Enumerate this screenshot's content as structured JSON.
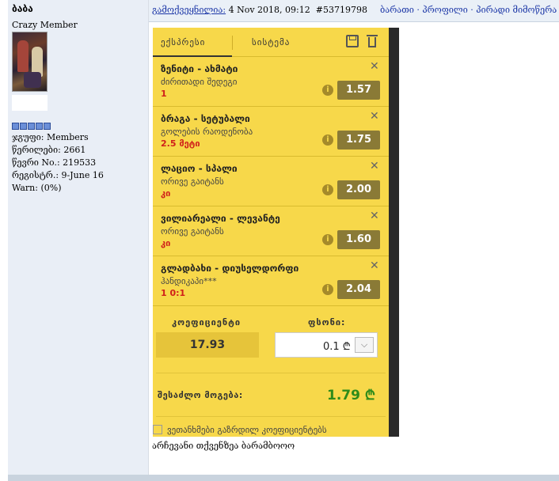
{
  "user": {
    "name": "ბაბა",
    "rank": "Crazy Member",
    "stats": [
      "ჯგუფი: Members",
      "წერილები: 2661",
      "წევრი No.: 219533",
      "რეგისტრ.: 9-June 16",
      "Warn: (0%)"
    ]
  },
  "post": {
    "link_label": "გამოქვეყნილია:",
    "date": "4 Nov 2018, 09:12",
    "post_id": "#53719798",
    "menu": "ბარათი · პროფილი · პირადი მიმოწერა"
  },
  "betslip": {
    "tab_express": "ექსპრესი",
    "tab_system": "სისტემა",
    "bets": [
      {
        "match": "ზენიტი - ახმატი",
        "market": "ძირითადი შედეგი",
        "pick": "1",
        "odds": "1.57"
      },
      {
        "match": "ბრაგა - სეტუბალი",
        "market": "გოლების რაოდენობა",
        "pick": "2.5 მეტი",
        "odds": "1.75"
      },
      {
        "match": "ლაციო - სპალი",
        "market": "ორივე გაიტანს",
        "pick": "კი",
        "odds": "2.00"
      },
      {
        "match": "ვილიარეალი - ლევანტე",
        "market": "ორივე გაიტანს",
        "pick": "კი",
        "odds": "1.60"
      },
      {
        "match": "გლადბახი - დიუსელდორფი",
        "market": "ჰანდიკაპი***",
        "pick": "1 0:1",
        "odds": "2.04"
      }
    ],
    "coef_label": "კოეფიციენტი",
    "amount_label": "ფსონი:",
    "coef_value": "17.93",
    "amount_value": "0.1 ₾",
    "payout_label": "შესაძლო მოგება:",
    "payout_value": "1.79 ₾",
    "accept_label": "ვეთანხმები გაზრდილ კოეფიციენტებს"
  },
  "caption": "არჩევანი თქვენზეა ბარამბოოო",
  "colors": {
    "slip_yellow": "#f7d84a",
    "odds_bg": "#8a7a36",
    "payout_green": "#2e8b1a",
    "pick_red": "#d0201a",
    "link_blue": "#1a35a6"
  }
}
